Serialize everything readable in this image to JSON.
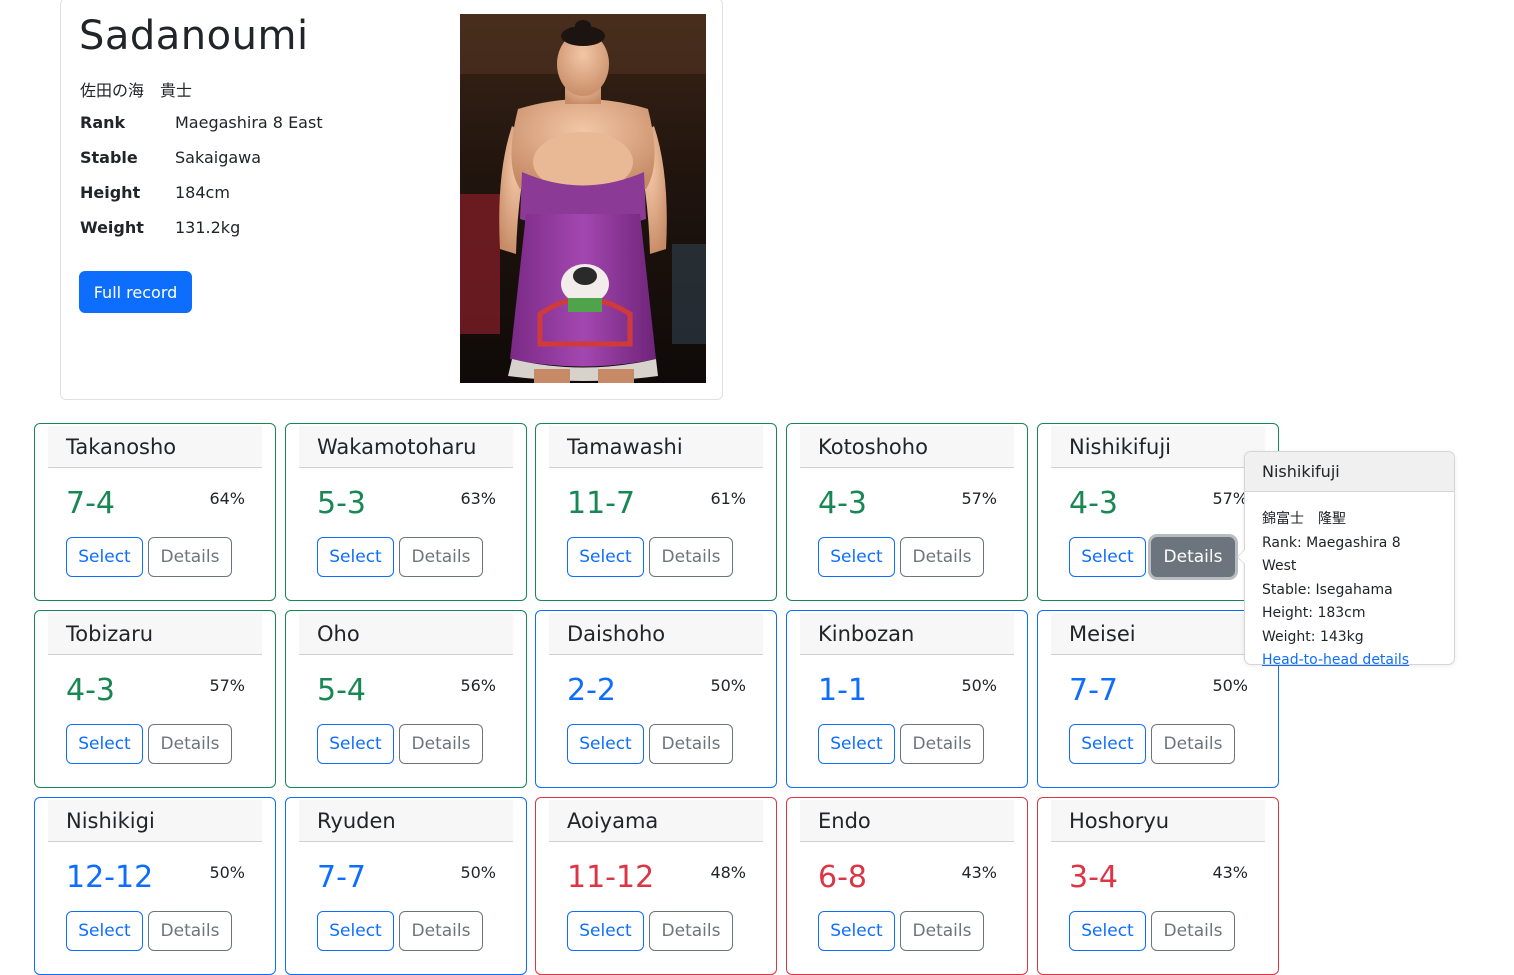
{
  "profile": {
    "name": "Sadanoumi",
    "name_jp": "佐田の海　貴士",
    "stats": [
      {
        "label": "Rank",
        "value": "Maegashira 8 East"
      },
      {
        "label": "Stable",
        "value": "Sakaigawa"
      },
      {
        "label": "Height",
        "value": "184cm"
      },
      {
        "label": "Weight",
        "value": "131.2kg"
      }
    ],
    "full_record_label": "Full record"
  },
  "buttons": {
    "select": "Select",
    "details": "Details"
  },
  "colors": {
    "winning": "#198754",
    "even": "#0d6efd",
    "losing": "#dc3545",
    "primary": "#0d6efd",
    "secondary": "#6c757d"
  },
  "opponents": [
    {
      "name": "Takanosho",
      "record": "7-4",
      "pct": "64%",
      "status": "winning"
    },
    {
      "name": "Wakamotoharu",
      "record": "5-3",
      "pct": "63%",
      "status": "winning"
    },
    {
      "name": "Tamawashi",
      "record": "11-7",
      "pct": "61%",
      "status": "winning"
    },
    {
      "name": "Kotoshoho",
      "record": "4-3",
      "pct": "57%",
      "status": "winning"
    },
    {
      "name": "Nishikifuji",
      "record": "4-3",
      "pct": "57%",
      "status": "winning",
      "details_active": true
    },
    {
      "name": "Tobizaru",
      "record": "4-3",
      "pct": "57%",
      "status": "winning"
    },
    {
      "name": "Oho",
      "record": "5-4",
      "pct": "56%",
      "status": "winning"
    },
    {
      "name": "Daishoho",
      "record": "2-2",
      "pct": "50%",
      "status": "even"
    },
    {
      "name": "Kinbozan",
      "record": "1-1",
      "pct": "50%",
      "status": "even"
    },
    {
      "name": "Meisei",
      "record": "7-7",
      "pct": "50%",
      "status": "even"
    },
    {
      "name": "Nishikigi",
      "record": "12-12",
      "pct": "50%",
      "status": "even"
    },
    {
      "name": "Ryuden",
      "record": "7-7",
      "pct": "50%",
      "status": "even"
    },
    {
      "name": "Aoiyama",
      "record": "11-12",
      "pct": "48%",
      "status": "losing"
    },
    {
      "name": "Endo",
      "record": "6-8",
      "pct": "43%",
      "status": "losing"
    },
    {
      "name": "Hoshoryu",
      "record": "3-4",
      "pct": "43%",
      "status": "losing"
    }
  ],
  "popover": {
    "title": "Nishikifuji",
    "name_jp": "錦富士　隆聖",
    "rank": "Rank: Maegashira 8 West",
    "stable": "Stable: Isegahama",
    "height": "Height: 183cm",
    "weight": "Weight: 143kg",
    "link": "Head-to-head details"
  }
}
